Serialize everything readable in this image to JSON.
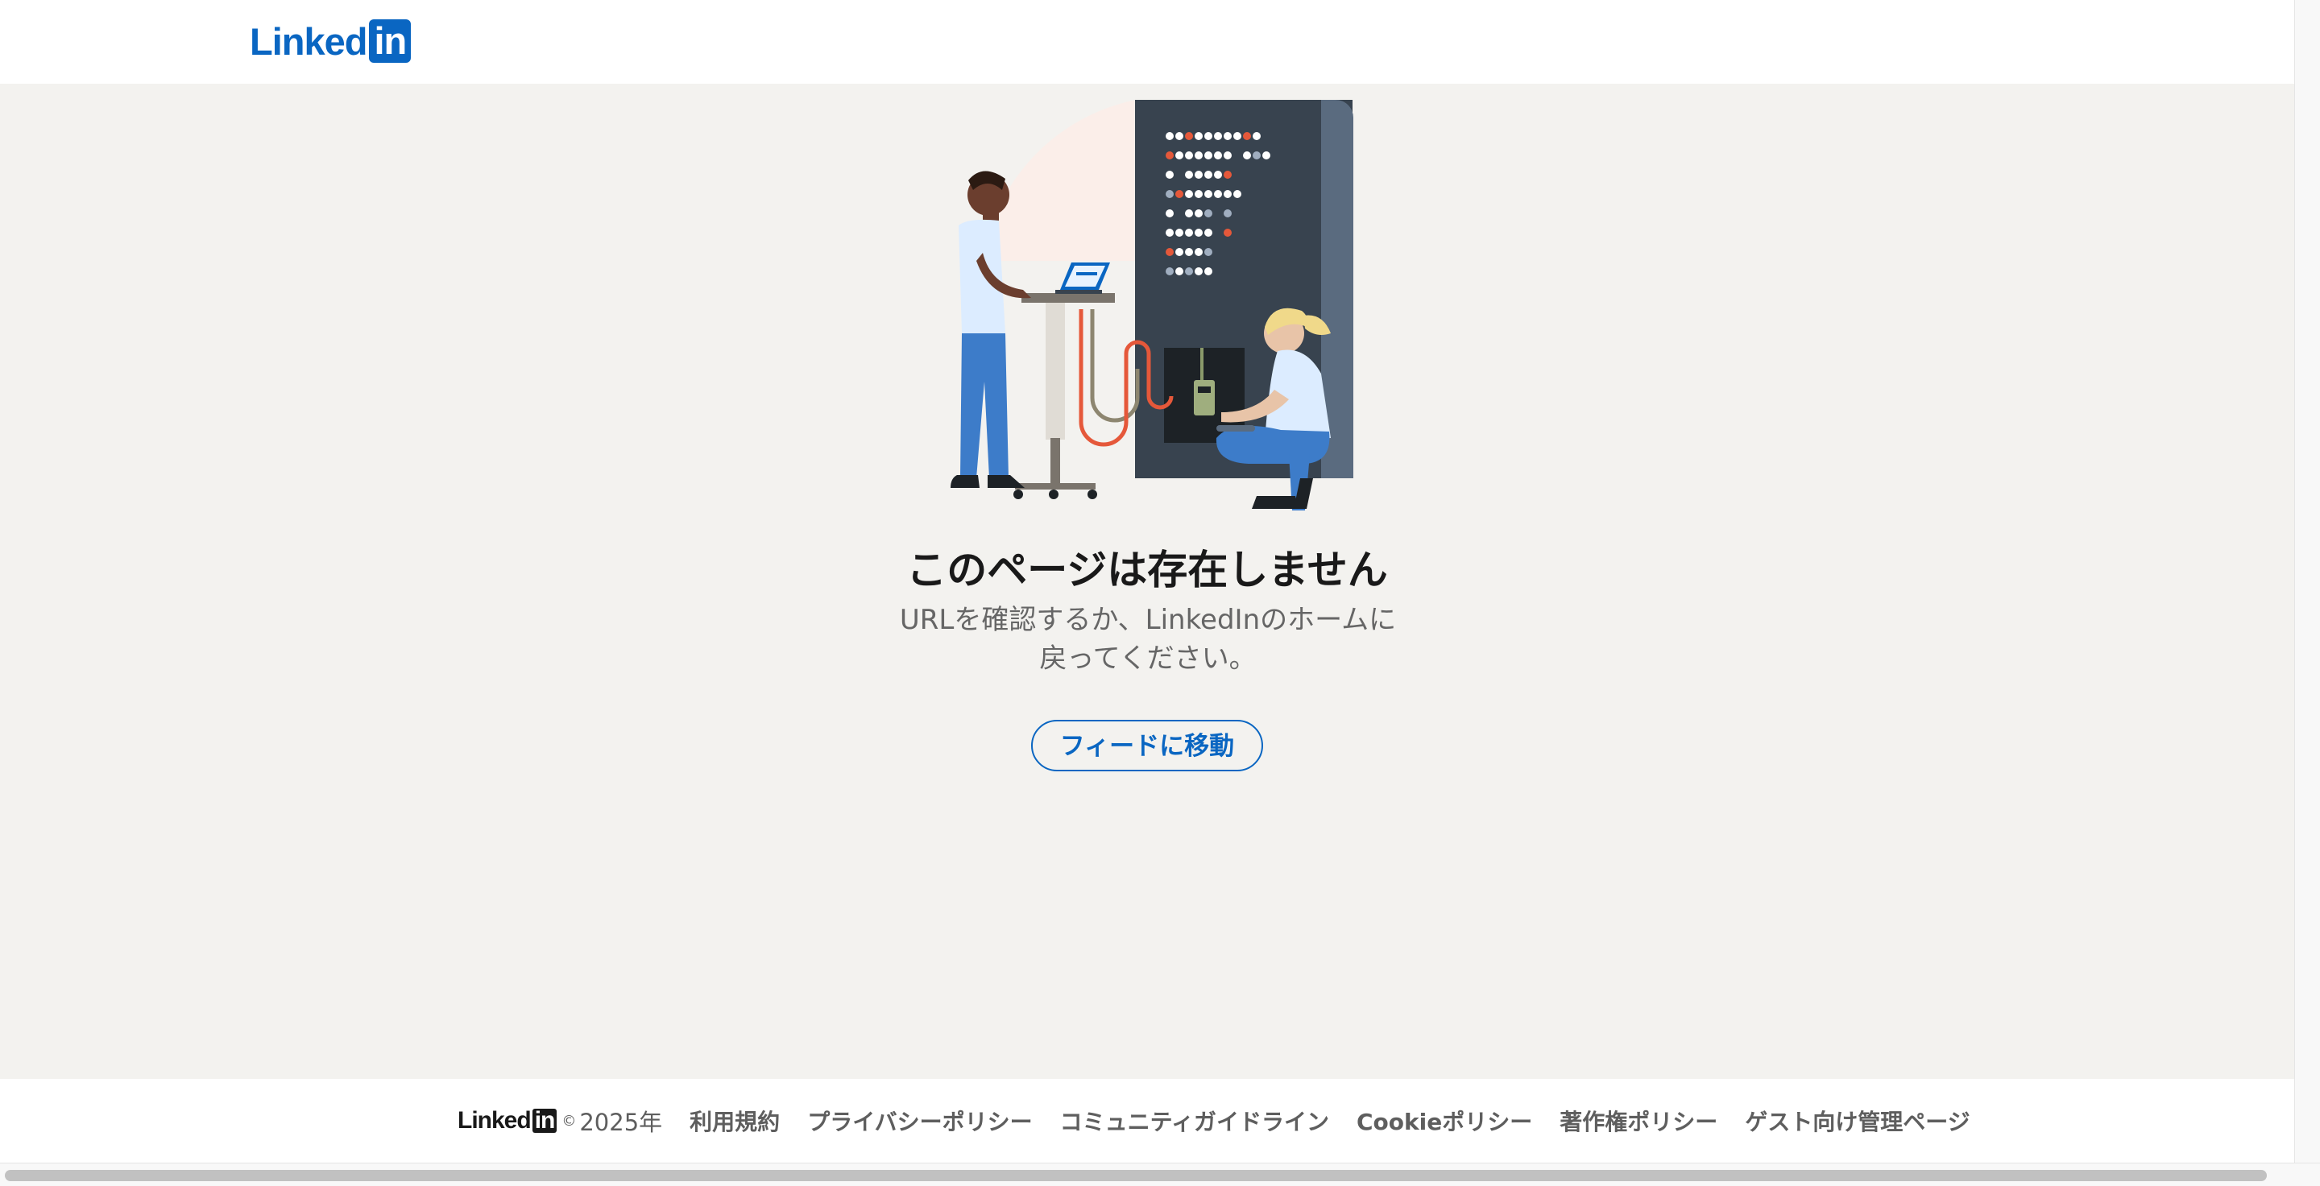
{
  "header": {
    "logo_text": "Linked",
    "logo_in": "in"
  },
  "main": {
    "illustration_icon": "server-technicians-illustration",
    "title": "このページは存在しません",
    "subtitle_line1": "URLを確認するか、LinkedInのホームに",
    "subtitle_line2": "戻ってください。",
    "feed_button_label": "フィードに移動"
  },
  "footer": {
    "logo_text": "Linked",
    "logo_in": "in",
    "copyright_symbol": "©",
    "year": "2025年",
    "links": [
      "利用規約",
      "プライバシーポリシー",
      "コミュニティガイドライン",
      "Cookieポリシー",
      "著作権ポリシー",
      "ゲスト向け管理ページ"
    ]
  },
  "colors": {
    "brand": "#0a66c2",
    "background": "#f3f2ef",
    "server": "#38434f",
    "accent_orange": "#e5583a"
  }
}
